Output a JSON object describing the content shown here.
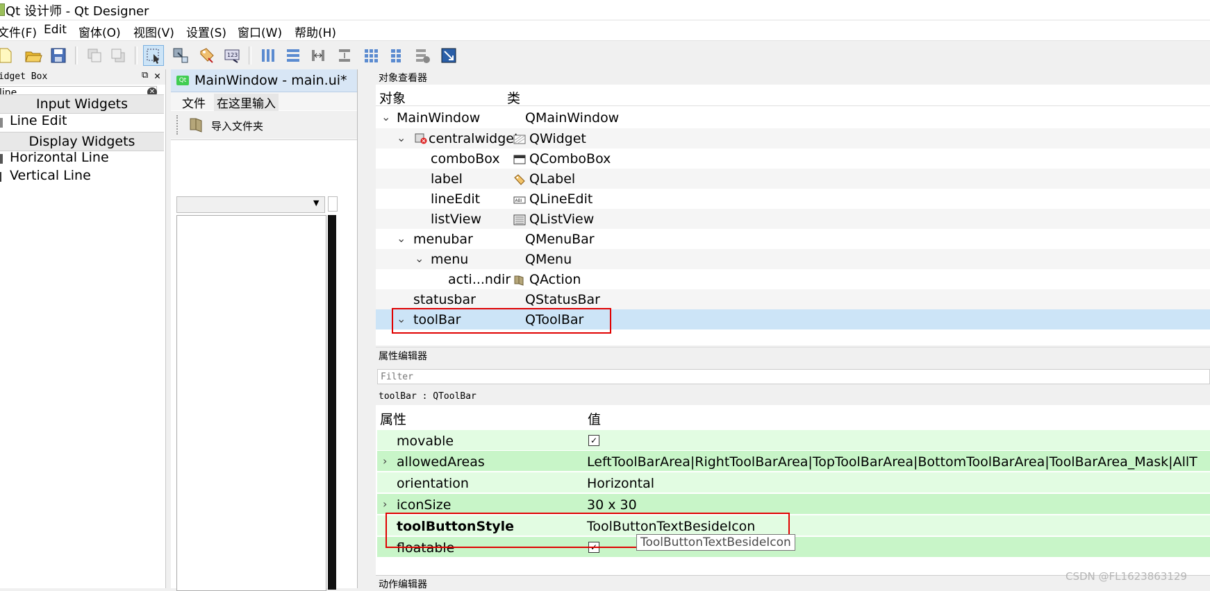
{
  "window": {
    "title": "Qt 设计师 - Qt Designer"
  },
  "menubar": {
    "items": [
      "文件(F)",
      "Edit",
      "窗体(O)",
      "视图(V)",
      "设置(S)",
      "窗口(W)",
      "帮助(H)"
    ]
  },
  "widget_box": {
    "title": "Widget Box",
    "filter_value": "line",
    "categories": [
      {
        "name": "Input Widgets",
        "items": [
          "Line Edit"
        ]
      },
      {
        "name": "Display Widgets",
        "items": [
          "Horizontal Line",
          "Vertical Line"
        ]
      }
    ]
  },
  "form_window": {
    "tab_title": "MainWindow - main.ui*",
    "menu": {
      "file": "文件",
      "type_here": "在这里输入"
    },
    "toolbar_action": "导入文件夹"
  },
  "object_inspector": {
    "title": "对象查看器",
    "columns": {
      "object": "对象",
      "class": "类"
    },
    "rows": [
      {
        "object": "MainWindow",
        "class": "QMainWindow",
        "icon": "none"
      },
      {
        "object": "centralwidget",
        "class": "QWidget",
        "icon": "qwidget-icon"
      },
      {
        "object": "comboBox",
        "class": "QComboBox",
        "icon": "combobox-icon"
      },
      {
        "object": "label",
        "class": "QLabel",
        "icon": "label-tag-icon"
      },
      {
        "object": "lineEdit",
        "class": "QLineEdit",
        "icon": "lineedit-icon"
      },
      {
        "object": "listView",
        "class": "QListView",
        "icon": "listview-icon"
      },
      {
        "object": "menubar",
        "class": "QMenuBar",
        "icon": "none"
      },
      {
        "object": "menu",
        "class": "QMenu",
        "icon": "none"
      },
      {
        "object": "acti...ndir",
        "class": "QAction",
        "icon": "action-folder-icon"
      },
      {
        "object": "statusbar",
        "class": "QStatusBar",
        "icon": "none"
      },
      {
        "object": "toolBar",
        "class": "QToolBar",
        "icon": "none",
        "selected": true
      }
    ]
  },
  "property_editor": {
    "title": "属性编辑器",
    "filter_placeholder": "Filter",
    "context": "toolBar : QToolBar",
    "columns": {
      "property": "属性",
      "value": "值"
    },
    "rows": [
      {
        "property": "movable",
        "value_checked": true
      },
      {
        "property": "allowedAreas",
        "value": "LeftToolBarArea|RightToolBarArea|TopToolBarArea|BottomToolBarArea|ToolBarArea_Mask|AllT"
      },
      {
        "property": "orientation",
        "value": "Horizontal"
      },
      {
        "property": "iconSize",
        "value": "30 x 30"
      },
      {
        "property": "toolButtonStyle",
        "value": "ToolButtonTextBesideIcon",
        "bold": true
      },
      {
        "property": "floatable",
        "value_checked": true
      }
    ],
    "tooltip": "ToolButtonTextBesideIcon"
  },
  "action_editor": {
    "title": "动作编辑器"
  },
  "watermark": "CSDN @FL1623863129",
  "colors": {
    "selection": "#cce4f7",
    "prop_light": "#e2fce2",
    "prop_dark": "#c8f5c8",
    "highlight_box": "#e00000"
  }
}
